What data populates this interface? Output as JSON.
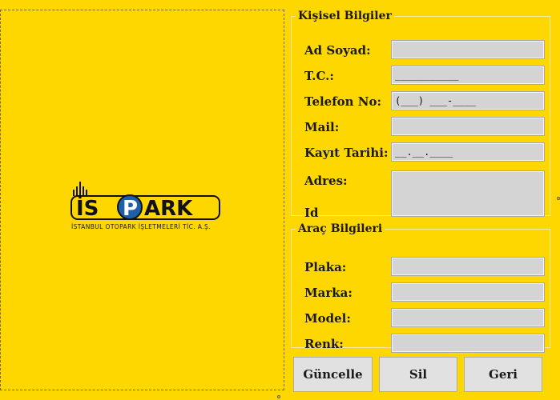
{
  "logo": {
    "brand_text": "ISPARK",
    "subtitle": "İSTANBUL OTOPARK İŞLETMELERİ TİC. A.Ş."
  },
  "personal": {
    "title": "Kişisel Bilgiler",
    "fields": [
      {
        "label": "Ad Soyad:",
        "value": ""
      },
      {
        "label": "T.C.:",
        "value": "___________"
      },
      {
        "label": "Telefon No:",
        "value": "(___) ___-____"
      },
      {
        "label": "Mail:",
        "value": ""
      },
      {
        "label": "Kayıt Tarihi:",
        "value": "__.__.____"
      },
      {
        "label": "Adres:",
        "value": ""
      },
      {
        "label": "Id",
        "value": ""
      }
    ]
  },
  "vehicle": {
    "title": "Araç Bilgileri",
    "fields": [
      {
        "label": "Plaka:",
        "value": ""
      },
      {
        "label": "Marka:",
        "value": ""
      },
      {
        "label": "Model:",
        "value": ""
      },
      {
        "label": "Renk:",
        "value": ""
      }
    ]
  },
  "buttons": {
    "update": "Güncelle",
    "delete": "Sil",
    "back": "Geri"
  },
  "colors": {
    "background": "#FFD700",
    "logo_blue": "#1E5FA8",
    "logo_dark": "#111111"
  }
}
